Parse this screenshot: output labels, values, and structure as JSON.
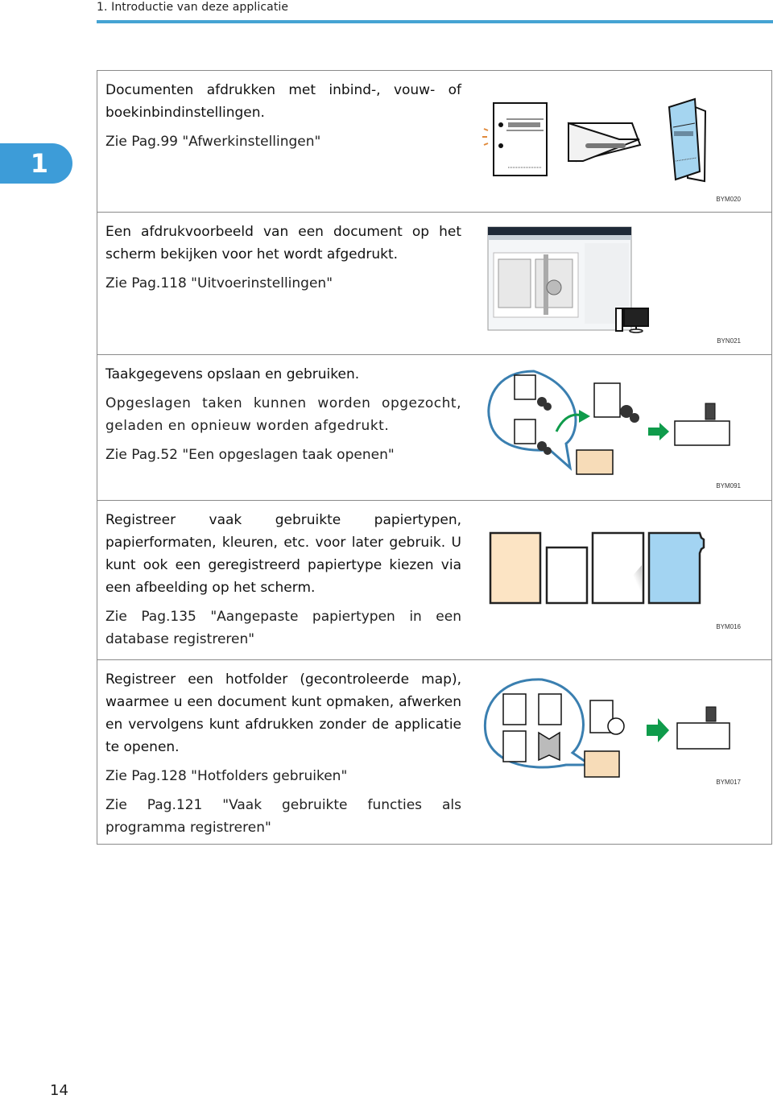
{
  "header": {
    "title": "1. Introductie van deze applicatie",
    "accent_color": "#45a3d3"
  },
  "chapter_tab": {
    "number": "1",
    "color": "#3d9cd8"
  },
  "rows": [
    {
      "heading": "Documenten afdrukken met inbind-, vouw- of boekinbindinstellingen.",
      "body": "",
      "refs": [
        "Zie Pag.99 \"Afwerkinstellingen\""
      ],
      "figure_code": "BYM020",
      "figure": "finishing-illustration"
    },
    {
      "heading": "Een afdrukvoorbeeld van een document op het scherm bekijken voor het wordt afgedrukt.",
      "body": "",
      "refs": [
        "Zie Pag.118 \"Uitvoerinstellingen\""
      ],
      "figure_code": "BYN021",
      "figure": "preview-screen-illustration"
    },
    {
      "heading": "Taakgegevens opslaan en gebruiken.",
      "body": "Opgeslagen taken kunnen worden opgezocht, geladen en opnieuw worden afgedrukt.",
      "refs": [
        "Zie Pag.52 \"Een opgeslagen taak openen\""
      ],
      "figure_code": "BYM091",
      "figure": "stored-jobs-illustration"
    },
    {
      "heading": "Registreer vaak gebruikte papiertypen, papierformaten, kleuren, etc. voor later gebruik. U kunt ook een geregistreerd papiertype kiezen via een afbeelding op het scherm.",
      "body": "",
      "refs": [
        "Zie Pag.135 \"Aangepaste papiertypen in een database registreren\""
      ],
      "figure_code": "BYM016",
      "figure": "paper-types-illustration"
    },
    {
      "heading": "Registreer een hotfolder (gecontroleerde map), waarmee u een document kunt opmaken, afwerken en vervolgens kunt afdrukken zonder de applicatie te openen.",
      "body": "",
      "refs": [
        "Zie Pag.128 \"Hotfolders gebruiken\"",
        "Zie Pag.121 \"Vaak gebruikte functies als programma registreren\""
      ],
      "figure_code": "BYM017",
      "figure": "hotfolder-illustration"
    }
  ],
  "page_number": "14"
}
